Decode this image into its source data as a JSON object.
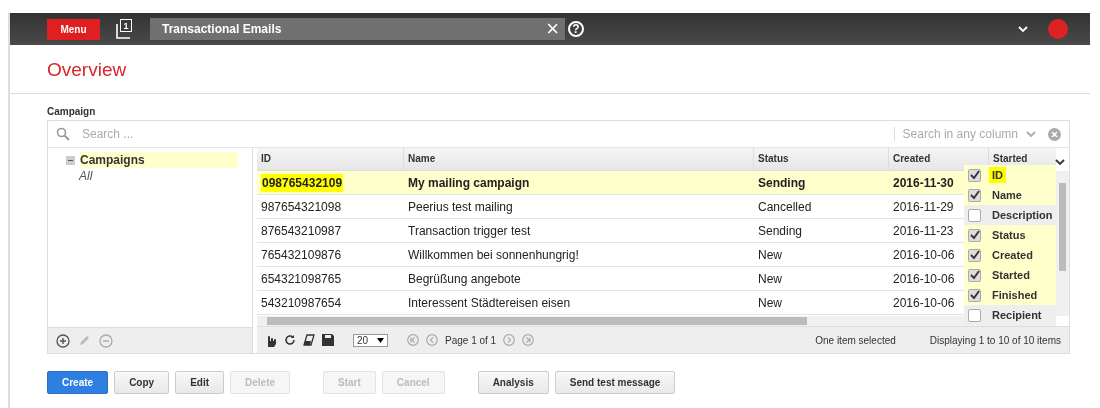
{
  "top_bar": {
    "menu_button": "Menu",
    "window_count": "1",
    "title": "Transactional Emails",
    "close": "×",
    "help": "?"
  },
  "page_title": "Overview",
  "section_label": "Campaign",
  "search": {
    "placeholder": "Search ...",
    "column_search": "Search in any column"
  },
  "tree": [
    {
      "label": "Campaigns",
      "expanded": true,
      "selected": true,
      "children": [
        {
          "label": "All",
          "selected": false
        }
      ]
    }
  ],
  "grid": {
    "columns": [
      {
        "label": "ID"
      },
      {
        "label": "Name"
      },
      {
        "label": "Status"
      },
      {
        "label": "Created"
      },
      {
        "label": "Started"
      }
    ],
    "rows": [
      {
        "selected": true,
        "cells": [
          "098765432109",
          "My mailing campaign",
          "Sending",
          "2016-11-30"
        ]
      },
      {
        "selected": false,
        "cells": [
          "987654321098",
          "Peerius test mailing",
          "Cancelled",
          "2016-11-29"
        ]
      },
      {
        "selected": false,
        "cells": [
          "876543210987",
          "Transaction trigger test",
          "Sending",
          "2016-11-23"
        ]
      },
      {
        "selected": false,
        "cells": [
          "765432109876",
          "Willkommen bei sonnenhungrig!",
          "New",
          "2016-10-06"
        ]
      },
      {
        "selected": false,
        "cells": [
          "654321098765",
          "Begrüßung angebote",
          "New",
          "2016-10-06"
        ]
      },
      {
        "selected": false,
        "cells": [
          "543210987654",
          "Interessent Städtereisen eisen",
          "New",
          "2016-10-06"
        ]
      }
    ],
    "column_menu": [
      {
        "label": "ID",
        "checked": true,
        "highlighted": true
      },
      {
        "label": "Name",
        "checked": true,
        "highlighted": false
      },
      {
        "label": "Description",
        "checked": false,
        "highlighted": false
      },
      {
        "label": "Status",
        "checked": true,
        "highlighted": false
      },
      {
        "label": "Created",
        "checked": true,
        "highlighted": false
      },
      {
        "label": "Started",
        "checked": true,
        "highlighted": false
      },
      {
        "label": "Finished",
        "checked": true,
        "highlighted": false
      },
      {
        "label": "Recipient",
        "checked": false,
        "highlighted": false
      }
    ],
    "pager": {
      "page_size": "20",
      "page_text": "Page 1 of 1",
      "selection_text": "One item selected",
      "display_text": "Displaying 1 to 10 of 10 items"
    }
  },
  "button_groups": [
    {
      "buttons": [
        {
          "label": "Create",
          "kind": "primary",
          "disabled": false
        },
        {
          "label": "Copy",
          "kind": "normal",
          "disabled": false
        },
        {
          "label": "Edit",
          "kind": "normal",
          "disabled": false
        },
        {
          "label": "Delete",
          "kind": "normal",
          "disabled": true
        }
      ]
    },
    {
      "buttons": [
        {
          "label": "Start",
          "kind": "normal",
          "disabled": true
        },
        {
          "label": "Cancel",
          "kind": "normal",
          "disabled": true
        }
      ]
    },
    {
      "buttons": [
        {
          "label": "Analysis",
          "kind": "normal",
          "disabled": false
        },
        {
          "label": "Send test message",
          "kind": "normal",
          "disabled": false
        }
      ]
    }
  ]
}
